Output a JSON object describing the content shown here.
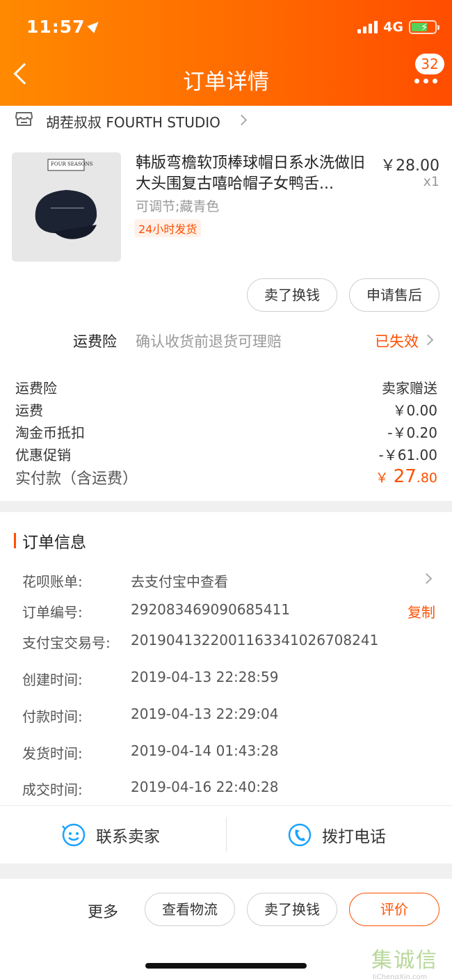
{
  "status_bar": {
    "time": "11:57",
    "network": "4G"
  },
  "header": {
    "title": "订单详情",
    "badge_count": "32"
  },
  "shop": {
    "name": "胡茬叔叔 FOURTH STUDIO"
  },
  "product": {
    "title": "韩版弯檐软顶棒球帽日系水洗做旧大头围复古嘻哈帽子女鸭舌...",
    "price": "￥28.00",
    "quantity": "x1",
    "spec": "可调节;藏青色",
    "tag": "24小时发货",
    "image_text": "FOUR SEASONS"
  },
  "item_actions": {
    "resell": "卖了换钱",
    "after_sale": "申请售后"
  },
  "insurance": {
    "label": "运费险",
    "desc": "确认收货前退货可理赔",
    "status": "已失效"
  },
  "fees": [
    {
      "label": "运费险",
      "value": "卖家赠送"
    },
    {
      "label": "运费",
      "value": "￥0.00"
    },
    {
      "label": "淘金币抵扣",
      "value": "-￥0.20"
    },
    {
      "label": "优惠促销",
      "value": "-￥61.00"
    }
  ],
  "total": {
    "label": "实付款（含运费）",
    "currency": "￥",
    "int": "27",
    "dec": ".80"
  },
  "order_info": {
    "title": "订单信息",
    "huabei": {
      "label": "花呗账单:",
      "value": "去支付宝中查看"
    },
    "order_no": {
      "label": "订单编号:",
      "value": "292083469090685411",
      "copy": "复制"
    },
    "alipay_no": {
      "label": "支付宝交易号:",
      "value": "2019041322001163341026708241"
    },
    "created": {
      "label": "创建时间:",
      "value": "2019-04-13 22:28:59"
    },
    "paid": {
      "label": "付款时间:",
      "value": "2019-04-13 22:29:04"
    },
    "shipped": {
      "label": "发货时间:",
      "value": "2019-04-14 01:43:28"
    },
    "completed": {
      "label": "成交时间:",
      "value": "2019-04-16 22:40:28"
    }
  },
  "contact": {
    "seller": "联系卖家",
    "call": "拨打电话"
  },
  "bottom_bar": {
    "more": "更多",
    "logistics": "查看物流",
    "resell": "卖了换钱",
    "review": "评价"
  },
  "watermark": {
    "cn": "集诚信",
    "en": "JiChengXin.com"
  },
  "colors": {
    "accent": "#ff5000",
    "header_start": "#ff8a00",
    "header_end": "#ff4d00",
    "contact_icon": "#1aa3ff"
  }
}
